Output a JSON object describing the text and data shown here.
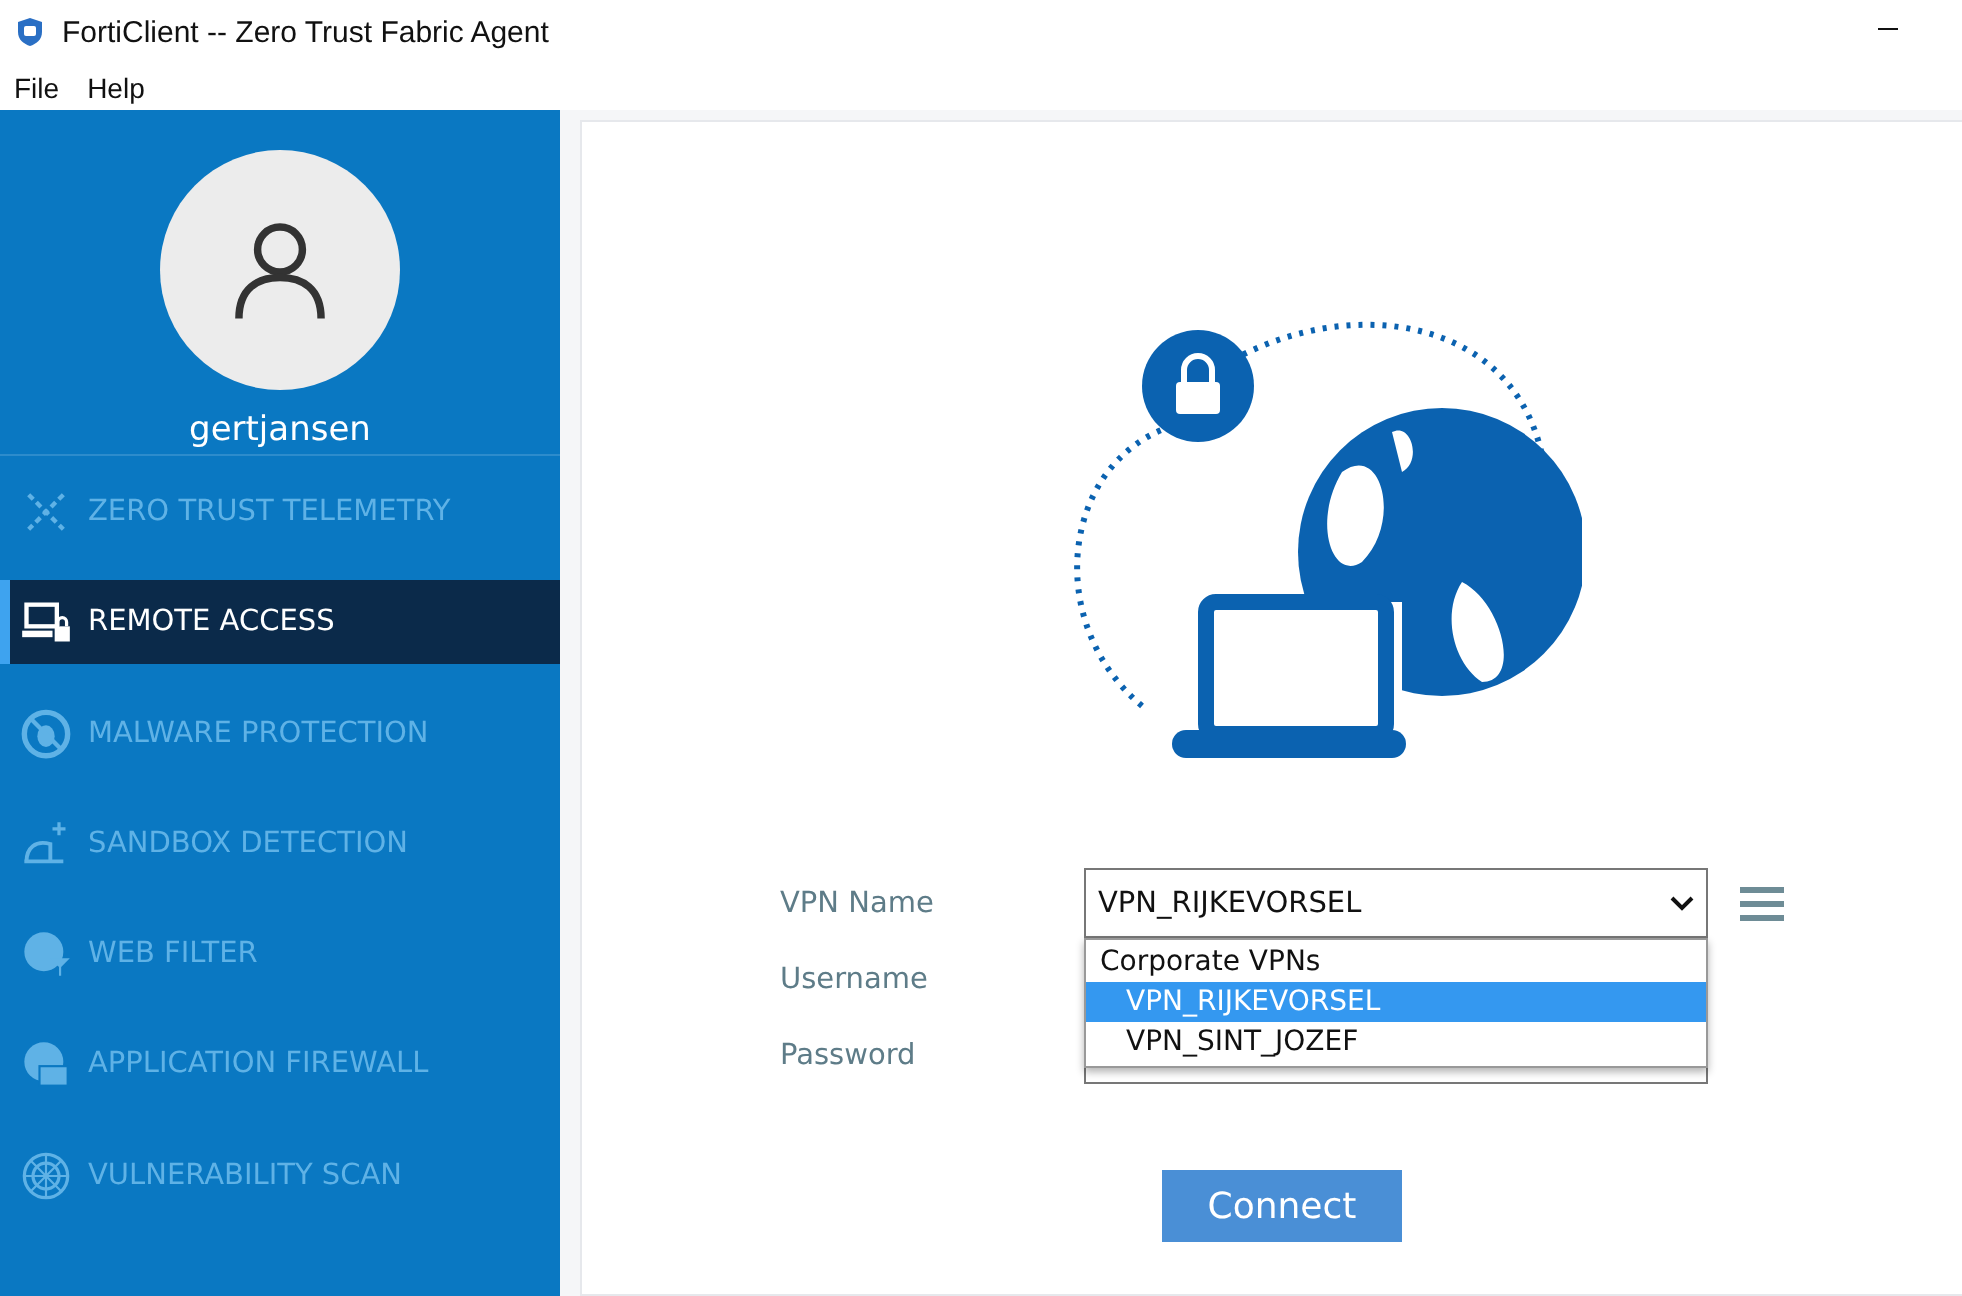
{
  "window": {
    "title": "FortiClient -- Zero Trust Fabric Agent"
  },
  "menu": [
    "File",
    "Help"
  ],
  "sidebar": {
    "user": "gertjansen",
    "items": [
      {
        "label": "ZERO TRUST TELEMETRY",
        "selected": false
      },
      {
        "label": "REMOTE ACCESS",
        "selected": true
      },
      {
        "label": "MALWARE PROTECTION",
        "selected": false
      },
      {
        "label": "SANDBOX DETECTION",
        "selected": false
      },
      {
        "label": "WEB FILTER",
        "selected": false
      },
      {
        "label": "APPLICATION FIREWALL",
        "selected": false
      },
      {
        "label": "VULNERABILITY SCAN",
        "selected": false
      }
    ]
  },
  "form": {
    "vpn_label": "VPN Name",
    "vpn_value": "VPN_RIJKEVORSEL",
    "username_label": "Username",
    "password_label": "Password",
    "dropdown": {
      "expanded": true,
      "group": "Corporate VPNs",
      "options": [
        {
          "label": "VPN_RIJKEVORSEL",
          "selected": true
        },
        {
          "label": "VPN_SINT_JOZEF",
          "selected": false
        }
      ]
    },
    "connect": "Connect"
  }
}
